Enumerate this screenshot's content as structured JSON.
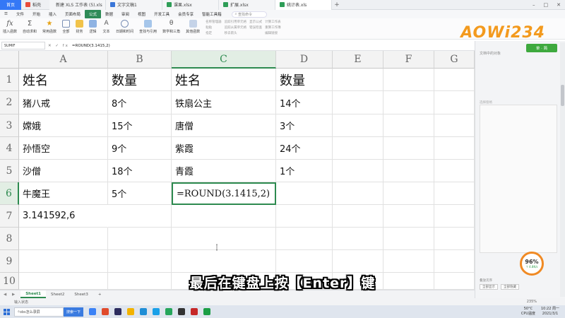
{
  "tabs": [
    {
      "label": "首页",
      "active": false
    },
    {
      "label": "稻壳",
      "active": false
    },
    {
      "label": "新建 XLS 工作表 (5).xls",
      "active": false
    },
    {
      "label": "文字文稿1",
      "active": false
    },
    {
      "label": "课果.xlsx",
      "active": false
    },
    {
      "label": "扩展.xlsx",
      "active": false
    },
    {
      "label": "姚计表.xls",
      "active": true
    }
  ],
  "menus": [
    "文件",
    "开始",
    "插入",
    "页面布局",
    "公式",
    "数据",
    "审阅",
    "视图",
    "开发工具",
    "会员专享",
    "智能工具箱"
  ],
  "active_menu": "公式",
  "search_command": "查找命令",
  "ribbon": [
    "插入函数",
    "自动求和",
    "常用函数",
    "全部",
    "财务",
    "逻辑",
    "文本",
    "日期和时间",
    "查找与引用",
    "数学和三角",
    "其他函数"
  ],
  "ribbon_small": [
    "名称管理器",
    "粘贴",
    "指定",
    "追踪引用单元格",
    "追踪从属单元格",
    "移去箭头",
    "显示公式",
    "错误检查",
    "计算工作表",
    "重算工作簿",
    "编辑链接"
  ],
  "logo": "AOWi234",
  "formula_bar": {
    "name_box": "SUMIF",
    "icons": "✕ ✓ fx",
    "formula": "=ROUND(3.1415,2)"
  },
  "columns": [
    "A",
    "B",
    "C",
    "D",
    "E",
    "F",
    "G"
  ],
  "rows": [
    "1",
    "2",
    "3",
    "4",
    "5",
    "6",
    "7",
    "8",
    "9",
    "10"
  ],
  "cells": {
    "A1": "姓名",
    "B1": "数量",
    "C1": "姓名",
    "D1": "数量",
    "A2": "猪八戒",
    "B2": "8个",
    "C2": "铁扇公主",
    "D2": "14个",
    "A3": "嫦娥",
    "B3": "15个",
    "C3": "唐僧",
    "D3": "3个",
    "A4": "孙悟空",
    "B4": "9个",
    "C4": "紫霞",
    "D4": "24个",
    "A5": "沙僧",
    "B5": "18个",
    "C5": "青霞",
    "D5": "1个",
    "A6": "牛魔王",
    "B6": "5个",
    "C6": "=ROUND(3.1415,2)",
    "A7": "3.141592,6"
  },
  "active_cell": "C6",
  "sheets": [
    "Sheet1",
    "Sheet2",
    "Sheet3"
  ],
  "active_sheet": "Sheet1",
  "status": {
    "mode": "输入状态",
    "zoom": "235%"
  },
  "pane": {
    "title": "文档中的对象",
    "toggle": "单 · 简",
    "subtitle": "选择窗格",
    "selection_label": "叠放次序",
    "buttons": [
      "全部显示",
      "全部隐藏"
    ],
    "badge_pct": "96%",
    "badge_speed": "↑ 4.8K/s"
  },
  "subtitle": "最后在键盘上按【Enter】键",
  "taskbar": {
    "search": "obs怎么录屏",
    "search_button": "搜索一下",
    "temp": "50°C",
    "cpu": "CPU温度",
    "time": "10:22 周一",
    "date": "2021/3/1"
  },
  "colors": {
    "accent_green": "#2d8a4f",
    "home_tab_blue": "#3478f6",
    "logo_orange": "#f39a1e"
  }
}
